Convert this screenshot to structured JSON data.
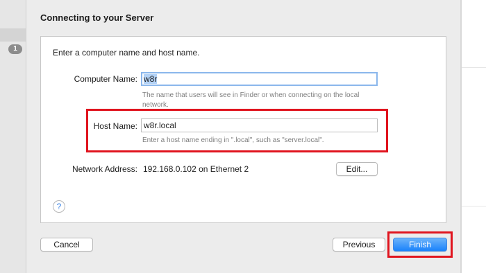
{
  "background": {
    "sidebar_badge": "1"
  },
  "dialog": {
    "title": "Connecting to your Server",
    "intro": "Enter a computer name and host name.",
    "computer_name": {
      "label": "Computer Name:",
      "value": "w8r",
      "hint": "The name that users will see in Finder or when connecting on the local network."
    },
    "host_name": {
      "label": "Host Name:",
      "value": "w8r.local",
      "hint": "Enter a host name ending in \".local\", such as \"server.local\"."
    },
    "network_address": {
      "label": "Network Address:",
      "value": "192.168.0.102 on Ethernet 2",
      "edit_label": "Edit..."
    },
    "help_icon": "?",
    "buttons": {
      "cancel": "Cancel",
      "previous": "Previous",
      "finish": "Finish"
    }
  },
  "colors": {
    "highlight": "#e0141e",
    "primary_button": "#1a82fb",
    "focus_ring": "#8bb7ec",
    "selection": "#b3d2f6"
  }
}
